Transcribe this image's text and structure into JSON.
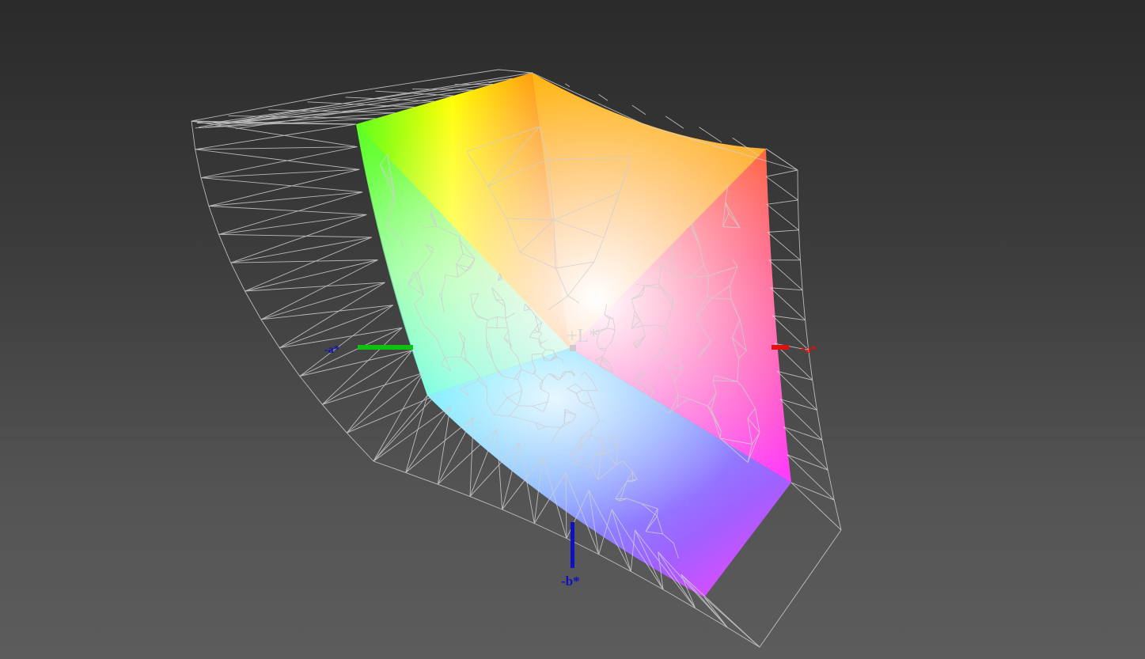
{
  "view": {
    "background_top": "#2a2a2a",
    "background_bottom": "#5c5c5c"
  },
  "axes": {
    "l_label": "+L*",
    "a_pos_label": "+a*",
    "a_neg_label": "-a*",
    "b_neg_label": "-b*",
    "a_pos_color": "#e01010",
    "a_neg_color": "#10c010",
    "b_color": "#1010c0",
    "l_color": "#d8d8d8"
  },
  "gamut": {
    "solid_corner_colors": {
      "green": "#5cff20",
      "yellow": "#ffff00",
      "orange": "#ff6a00",
      "red": "#ff2040",
      "magenta": "#ff40ff",
      "violet": "#a060ff",
      "blue": "#6090ff",
      "cyan": "#40ffff",
      "white": "#ffffff"
    },
    "wireframe_color": "#d0d0d0"
  }
}
